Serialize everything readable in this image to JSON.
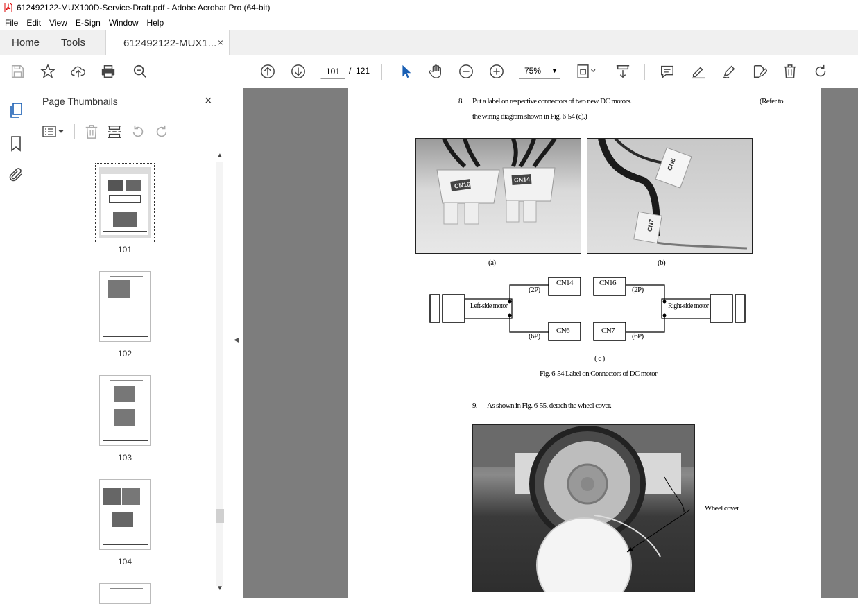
{
  "window": {
    "title": "612492122-MUX100D-Service-Draft.pdf - Adobe Acrobat Pro (64-bit)"
  },
  "menu": [
    "File",
    "Edit",
    "View",
    "E-Sign",
    "Window",
    "Help"
  ],
  "tabs": {
    "home": "Home",
    "tools": "Tools",
    "doc": "612492122-MUX1...",
    "doc_close": "×"
  },
  "toolbar": {
    "current_page": "101",
    "page_sep": "/",
    "total_pages": "121",
    "zoom": "75%"
  },
  "thumbs": {
    "title": "Page Thumbnails",
    "close": "×",
    "pages": [
      "101",
      "102",
      "103",
      "104"
    ]
  },
  "doc": {
    "step8_num": "8.",
    "step8_text": "Put a label on respective connectors of two new DC motors.",
    "step8_ref": "(Refer to",
    "step8_text2": "the wiring diagram shown in Fig. 6-54 (c).)",
    "cap_a": "(a)",
    "cap_b": "(b)",
    "photo_a_label1": "CN16",
    "photo_a_label2": "CN14",
    "photo_b_label1": "CN6",
    "photo_b_label2": "CN7",
    "diagram": {
      "cn14": "CN14",
      "cn16": "CN16",
      "cn6": "CN6",
      "cn7": "CN7",
      "p2_left": "(2P)",
      "p2_right": "(2P)",
      "p6_left": "(6P)",
      "p6_right": "(6P)",
      "left_motor": "Left-side motor",
      "right_motor": "Right-side motor"
    },
    "cap_c": "( c )",
    "fig_caption": "Fig. 6-54 Label on Connectors of DC motor",
    "step9_num": "9.",
    "step9_text": "As shown in Fig. 6-55, detach the wheel cover.",
    "wheel_label": "Wheel cover"
  }
}
